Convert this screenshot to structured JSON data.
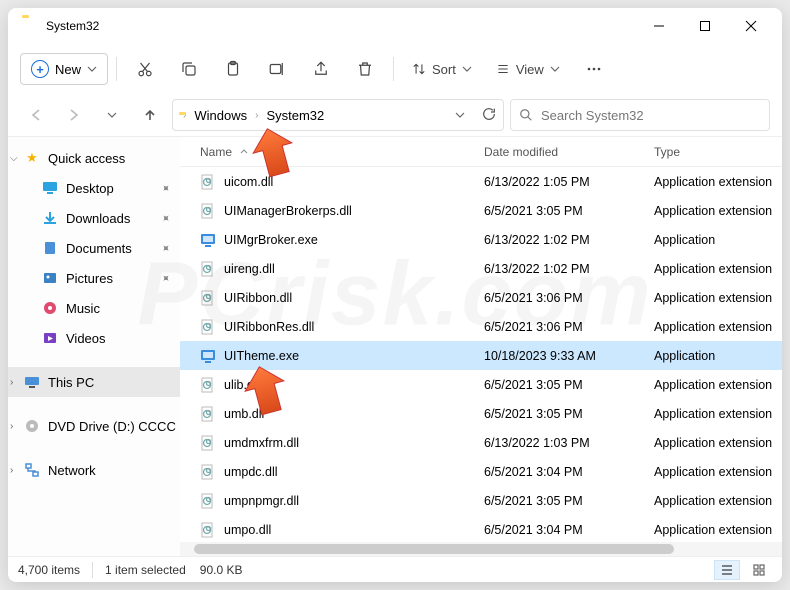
{
  "window": {
    "title": "System32"
  },
  "toolbar": {
    "new_label": "New",
    "sort_label": "Sort",
    "view_label": "View"
  },
  "breadcrumbs": [
    "Windows",
    "System32"
  ],
  "search_placeholder": "Search System32",
  "sidebar": {
    "quick_access": "Quick access",
    "items": [
      {
        "label": "Desktop"
      },
      {
        "label": "Downloads"
      },
      {
        "label": "Documents"
      },
      {
        "label": "Pictures"
      },
      {
        "label": "Music"
      },
      {
        "label": "Videos"
      }
    ],
    "this_pc": "This PC",
    "dvd": "DVD Drive (D:) CCCC",
    "network": "Network"
  },
  "columns": {
    "name": "Name",
    "date": "Date modified",
    "type": "Type"
  },
  "files": [
    {
      "name": "uicom.dll",
      "date": "6/13/2022 1:05 PM",
      "type": "Application extension",
      "icon": "dll"
    },
    {
      "name": "UIManagerBrokerps.dll",
      "date": "6/5/2021 3:05 PM",
      "type": "Application extension",
      "icon": "dll"
    },
    {
      "name": "UIMgrBroker.exe",
      "date": "6/13/2022 1:02 PM",
      "type": "Application",
      "icon": "exe"
    },
    {
      "name": "uireng.dll",
      "date": "6/13/2022 1:02 PM",
      "type": "Application extension",
      "icon": "dll"
    },
    {
      "name": "UIRibbon.dll",
      "date": "6/5/2021 3:06 PM",
      "type": "Application extension",
      "icon": "dll"
    },
    {
      "name": "UIRibbonRes.dll",
      "date": "6/5/2021 3:06 PM",
      "type": "Application extension",
      "icon": "dll"
    },
    {
      "name": "UITheme.exe",
      "date": "10/18/2023 9:33 AM",
      "type": "Application",
      "icon": "exe",
      "selected": true
    },
    {
      "name": "ulib.dll",
      "date": "6/5/2021 3:05 PM",
      "type": "Application extension",
      "icon": "dll"
    },
    {
      "name": "umb.dll",
      "date": "6/5/2021 3:05 PM",
      "type": "Application extension",
      "icon": "dll"
    },
    {
      "name": "umdmxfrm.dll",
      "date": "6/13/2022 1:03 PM",
      "type": "Application extension",
      "icon": "dll"
    },
    {
      "name": "umpdc.dll",
      "date": "6/5/2021 3:04 PM",
      "type": "Application extension",
      "icon": "dll"
    },
    {
      "name": "umpnpmgr.dll",
      "date": "6/5/2021 3:05 PM",
      "type": "Application extension",
      "icon": "dll"
    },
    {
      "name": "umpo.dll",
      "date": "6/5/2021 3:04 PM",
      "type": "Application extension",
      "icon": "dll"
    }
  ],
  "statusbar": {
    "count": "4,700 items",
    "selected": "1 item selected",
    "size": "90.0 KB"
  }
}
